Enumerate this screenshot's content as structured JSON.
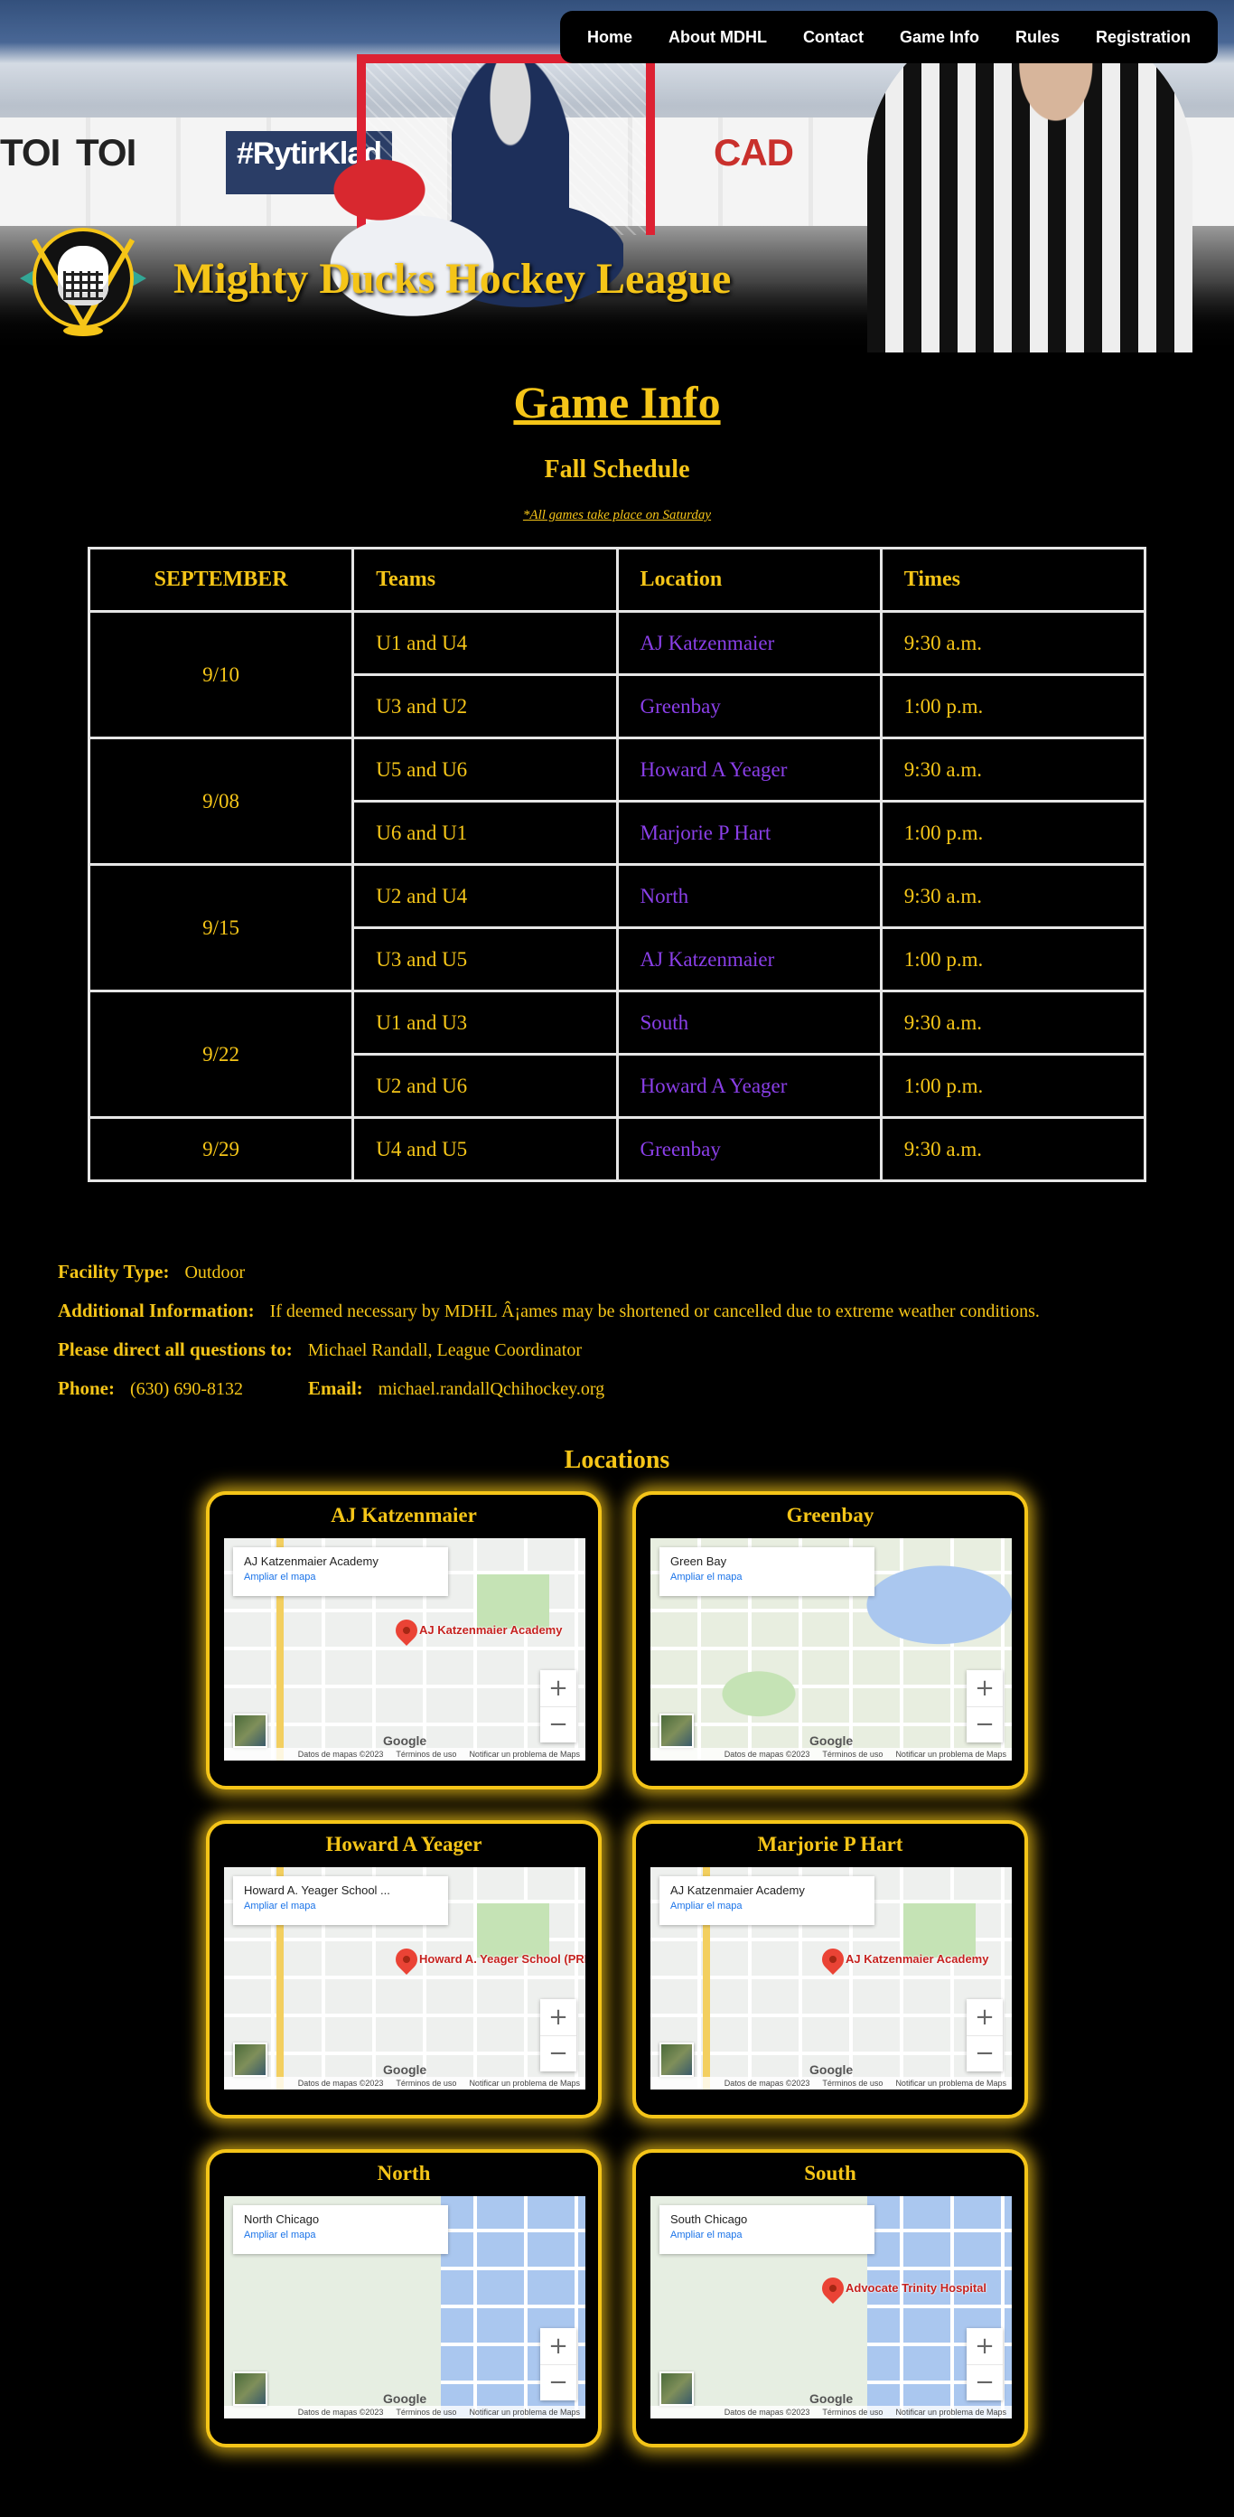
{
  "nav": {
    "items": [
      "Home",
      "About MDHL",
      "Contact",
      "Game Info",
      "Rules",
      "Registration"
    ]
  },
  "brand": {
    "title": "Mighty Ducks Hockey League"
  },
  "hero_ads": [
    "TOI",
    "TOI",
    "#RytirKlad",
    "CAD"
  ],
  "page": {
    "title": "Game Info",
    "subtitle": "Fall Schedule",
    "note": "*All games take place on Saturday"
  },
  "schedule": {
    "headers": [
      "SEPTEMBER",
      "Teams",
      "Location",
      "Times"
    ],
    "groups": [
      {
        "date": "9/10",
        "games": [
          {
            "teams": "U1 and U4",
            "location": "AJ Katzenmaier",
            "time": "9:30 a.m."
          },
          {
            "teams": "U3 and U2",
            "location": "Greenbay",
            "time": "1:00 p.m."
          }
        ]
      },
      {
        "date": "9/08",
        "games": [
          {
            "teams": "U5 and U6",
            "location": "Howard A Yeager",
            "time": "9:30 a.m."
          },
          {
            "teams": "U6 and U1",
            "location": "Marjorie P Hart",
            "time": "1:00 p.m."
          }
        ]
      },
      {
        "date": "9/15",
        "games": [
          {
            "teams": "U2 and U4",
            "location": "North",
            "time": "9:30 a.m."
          },
          {
            "teams": "U3 and U5",
            "location": "AJ Katzenmaier",
            "time": "1:00 p.m."
          }
        ]
      },
      {
        "date": "9/22",
        "games": [
          {
            "teams": "U1 and U3",
            "location": "South",
            "time": "9:30 a.m."
          },
          {
            "teams": "U2 and U6",
            "location": "Howard A Yeager",
            "time": "1:00 p.m."
          }
        ]
      },
      {
        "date": "9/29",
        "games": [
          {
            "teams": "U4 and U5",
            "location": "Greenbay",
            "time": "9:30 a.m."
          }
        ]
      }
    ]
  },
  "info": {
    "facility_label": "Facility Type:",
    "facility_value": "Outdoor",
    "additional_label": "Additional Information:",
    "additional_value": "If deemed necessary by MDHL Â¡ames may be shortened or cancelled due to extreme weather conditions.",
    "questions_label": "Please direct all questions to:",
    "questions_value": "Michael Randall, League Coordinator",
    "phone_label": "Phone:",
    "phone_value": "(630) 690-8132",
    "email_label": "Email:",
    "email_value": "michael.randallQchihockey.org"
  },
  "locations": {
    "title": "Locations",
    "cards": [
      {
        "name": "AJ Katzenmaier",
        "map_place": "AJ Katzenmaier Academy",
        "map_link": "Ampliar el mapa",
        "pin_label": "AJ Katzenmaier Academy",
        "style": ""
      },
      {
        "name": "Greenbay",
        "map_place": "Green Bay",
        "map_link": "Ampliar el mapa",
        "pin_label": "",
        "style": "green"
      },
      {
        "name": "Howard A Yeager",
        "map_place": "Howard A. Yeager School ...",
        "map_link": "Ampliar el mapa",
        "pin_label": "Howard A. Yeager School (PREK-K)",
        "style": ""
      },
      {
        "name": "Marjorie P Hart",
        "map_place": "AJ Katzenmaier Academy",
        "map_link": "Ampliar el mapa",
        "pin_label": "AJ Katzenmaier Academy",
        "style": ""
      },
      {
        "name": "North",
        "map_place": "North Chicago",
        "map_link": "Ampliar el mapa",
        "pin_label": "",
        "style": "water"
      },
      {
        "name": "South",
        "map_place": "South Chicago",
        "map_link": "Ampliar el mapa",
        "pin_label": "Advocate Trinity Hospital",
        "style": "water"
      }
    ],
    "map_google": "Google",
    "map_attrib": [
      "Datos de mapas ©2023",
      "Términos de uso",
      "Notificar un problema de Maps"
    ],
    "zoom_in": "+",
    "zoom_out": "−"
  },
  "colors": {
    "accent": "#f5c518",
    "location_link": "#8a3fe8",
    "background": "#000000"
  }
}
